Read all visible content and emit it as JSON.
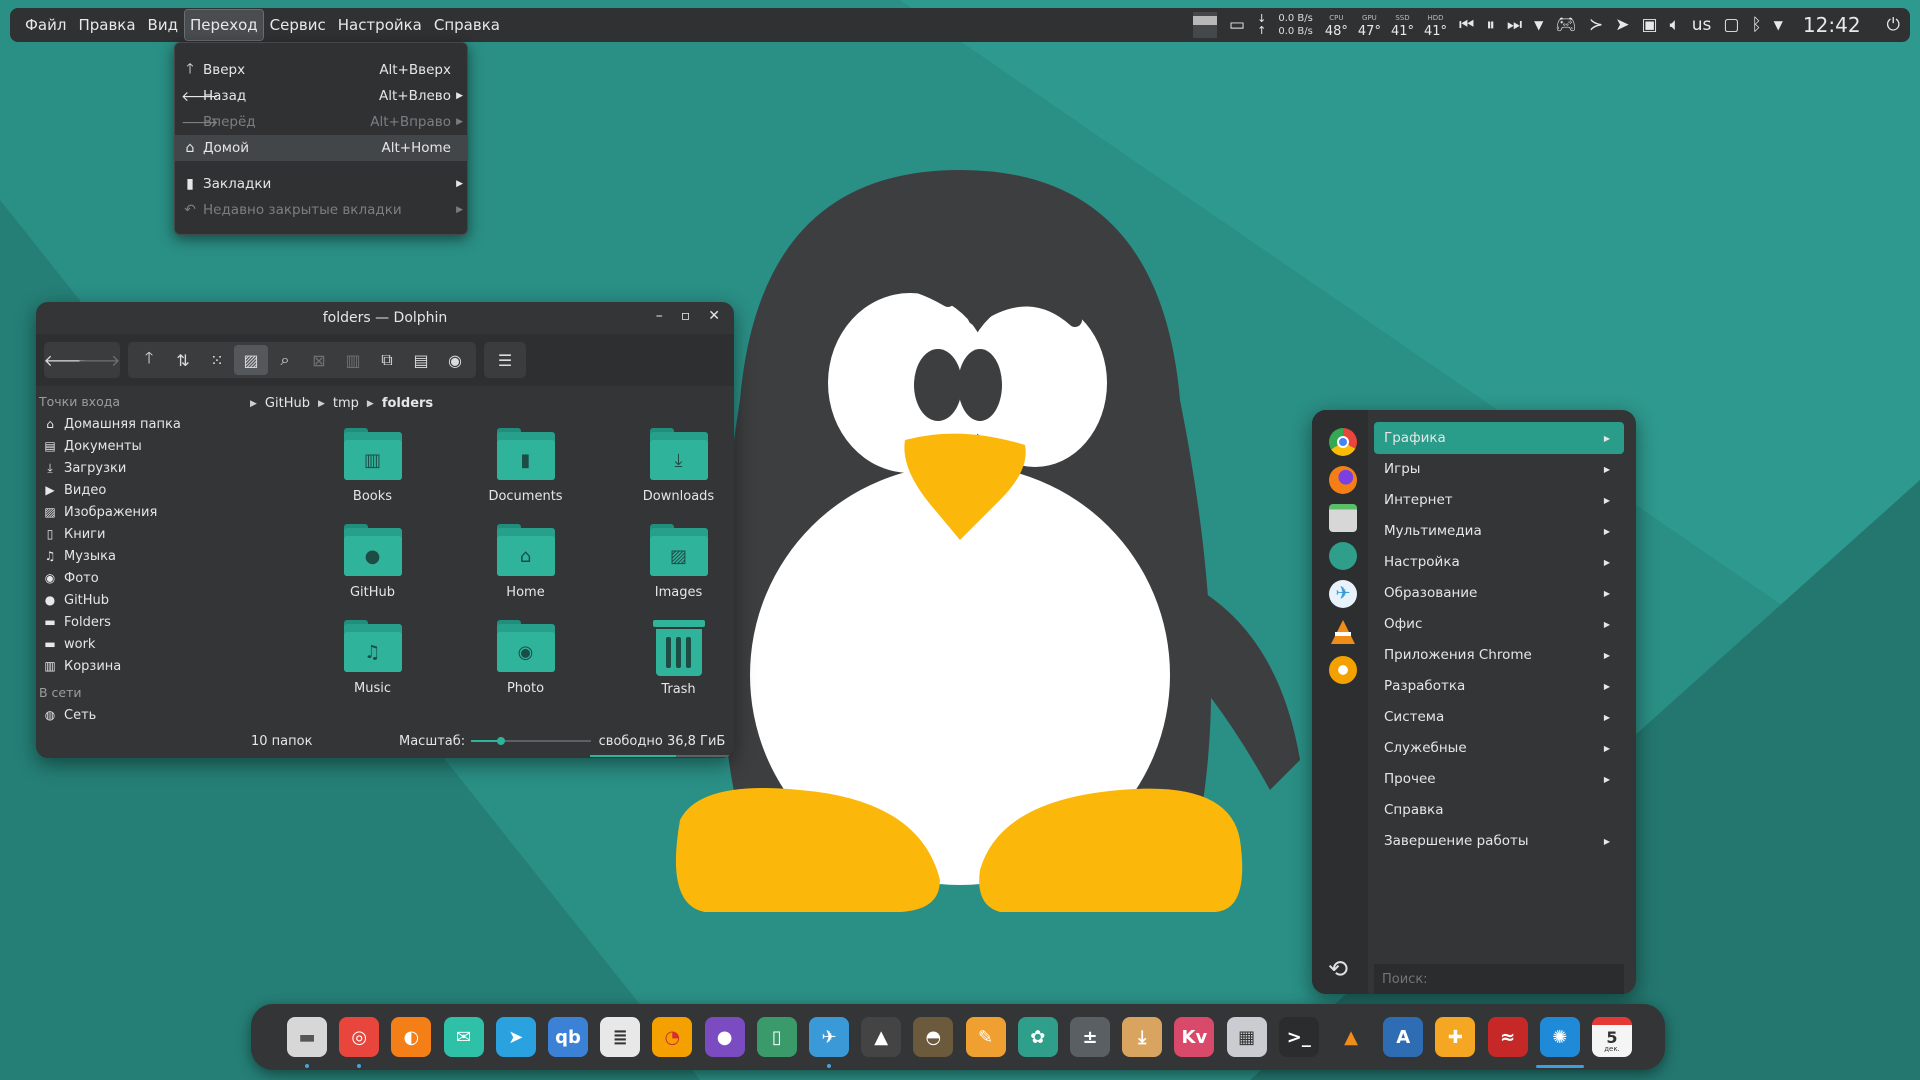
{
  "panel": {
    "menus": [
      "Файл",
      "Правка",
      "Вид",
      "Переход",
      "Сервис",
      "Настройка",
      "Справка"
    ],
    "active_menu": "Переход",
    "net_down": "0.0 B/s",
    "net_up": "0.0 B/s",
    "sensors": [
      {
        "label": "CPU",
        "value": "48°"
      },
      {
        "label": "GPU",
        "value": "47°"
      },
      {
        "label": "SSD",
        "value": "41°"
      },
      {
        "label": "HDD",
        "value": "41°"
      }
    ],
    "keyboard_layout": "us",
    "clock": "12:42"
  },
  "go_menu": {
    "items": [
      {
        "icon": "arrow-up-icon",
        "glyph": "🡑",
        "label": "Вверх",
        "shortcut": "Alt+Вверх",
        "disabled": false,
        "submenu": false
      },
      {
        "icon": "arrow-left-icon",
        "glyph": "🡐",
        "label": "Назад",
        "shortcut": "Alt+Влево",
        "disabled": false,
        "submenu": true
      },
      {
        "icon": "arrow-right-icon",
        "glyph": "🡒",
        "label": "Вперёд",
        "shortcut": "Alt+Вправо",
        "disabled": true,
        "submenu": true
      },
      {
        "icon": "home-icon",
        "glyph": "⌂",
        "label": "Домой",
        "shortcut": "Alt+Home",
        "disabled": false,
        "submenu": false,
        "highlighted": true
      },
      {
        "icon": "bookmark-icon",
        "glyph": "▮",
        "label": "Закладки",
        "shortcut": "",
        "disabled": false,
        "submenu": true
      },
      {
        "icon": "undo-icon",
        "glyph": "↶",
        "label": "Недавно закрытые вкладки",
        "shortcut": "",
        "disabled": true,
        "submenu": true
      }
    ]
  },
  "dolphin": {
    "title": "folders — Dolphin",
    "places_header": "Точки входа",
    "places": [
      {
        "icon": "home-icon",
        "glyph": "⌂",
        "label": "Домашняя папка"
      },
      {
        "icon": "document-icon",
        "glyph": "▤",
        "label": "Документы"
      },
      {
        "icon": "download-icon",
        "glyph": "⤓",
        "label": "Загрузки"
      },
      {
        "icon": "video-icon",
        "glyph": "▶",
        "label": "Видео"
      },
      {
        "icon": "image-icon",
        "glyph": "▨",
        "label": "Изображения"
      },
      {
        "icon": "book-icon",
        "glyph": "▯",
        "label": "Книги"
      },
      {
        "icon": "music-icon",
        "glyph": "♫",
        "label": "Музыка"
      },
      {
        "icon": "camera-icon",
        "glyph": "◉",
        "label": "Фото"
      },
      {
        "icon": "github-icon",
        "glyph": "●",
        "label": "GitHub"
      },
      {
        "icon": "folder-icon",
        "glyph": "▬",
        "label": "Folders"
      },
      {
        "icon": "folder-icon",
        "glyph": "▬",
        "label": "work"
      },
      {
        "icon": "trash-icon",
        "glyph": "▥",
        "label": "Корзина"
      }
    ],
    "network_header": "В сети",
    "network_item": "Сеть",
    "breadcrumb": [
      "GitHub",
      "tmp",
      "folders"
    ],
    "files": [
      {
        "name": "Books",
        "icon": "book-icon",
        "glyph": "▥"
      },
      {
        "name": "Documents",
        "icon": "document-icon",
        "glyph": "▮"
      },
      {
        "name": "Downloads",
        "icon": "download-icon",
        "glyph": "⤓"
      },
      {
        "name": "GitHub",
        "icon": "github-icon",
        "glyph": "●"
      },
      {
        "name": "Home",
        "icon": "home-icon",
        "glyph": "⌂"
      },
      {
        "name": "Images",
        "icon": "image-icon",
        "glyph": "▨"
      },
      {
        "name": "Music",
        "icon": "music-icon",
        "glyph": "♫"
      },
      {
        "name": "Photo",
        "icon": "camera-icon",
        "glyph": "◉"
      },
      {
        "name": "Trash",
        "icon": "trash-icon",
        "glyph": ""
      }
    ],
    "status_count": "10 папок",
    "zoom_label": "Масштаб:",
    "zoom_level": 0.25,
    "free_space": "свободно 36,8 ГиБ",
    "disk_usage": 0.6
  },
  "launcher": {
    "categories": [
      {
        "label": "Графика",
        "submenu": true,
        "selected": true
      },
      {
        "label": "Игры",
        "submenu": true
      },
      {
        "label": "Интернет",
        "submenu": true
      },
      {
        "label": "Мультимедиа",
        "submenu": true
      },
      {
        "label": "Настройка",
        "submenu": true
      },
      {
        "label": "Образование",
        "submenu": true
      },
      {
        "label": "Офис",
        "submenu": true
      },
      {
        "label": "Приложения Chrome",
        "submenu": true
      },
      {
        "label": "Разработка",
        "submenu": true
      },
      {
        "label": "Система",
        "submenu": true
      },
      {
        "label": "Служебные",
        "submenu": true
      },
      {
        "label": "Прочее",
        "submenu": true
      },
      {
        "label": "Справка",
        "submenu": false
      },
      {
        "label": "Завершение работы",
        "submenu": true
      }
    ],
    "favorites": [
      "chrome-icon",
      "firefox-icon",
      "file-manager-icon",
      "settings-icon",
      "kde-connect-icon",
      "vlc-icon",
      "citrus-icon"
    ],
    "search_placeholder": "Поиск:"
  },
  "dock": {
    "apps": [
      {
        "name": "file-manager-icon",
        "glyph": "▬",
        "bg": "#d7d7d7",
        "fg": "#555",
        "running": true
      },
      {
        "name": "chrome-icon",
        "glyph": "◎",
        "bg": "#e8453c",
        "fg": "#fff",
        "running": true
      },
      {
        "name": "firefox-icon",
        "glyph": "◐",
        "bg": "#f57f17",
        "fg": "#fff",
        "running": false
      },
      {
        "name": "mail-icon",
        "glyph": "✉",
        "bg": "#2fc0a8",
        "fg": "#fff",
        "running": false
      },
      {
        "name": "telegram-icon",
        "glyph": "➤",
        "bg": "#2aa2e0",
        "fg": "#fff",
        "running": false
      },
      {
        "name": "qbittorrent-icon",
        "glyph": "qb",
        "bg": "#3b82d6",
        "fg": "#fff",
        "running": false
      },
      {
        "name": "ebook-reader-icon",
        "glyph": "≣",
        "bg": "#e8e8e8",
        "fg": "#333",
        "running": false
      },
      {
        "name": "disc-burner-icon",
        "glyph": "◔",
        "bg": "#f4a100",
        "fg": "#d32f2f",
        "running": false
      },
      {
        "name": "github-desktop-icon",
        "glyph": "●",
        "bg": "#7b4bc2",
        "fg": "#fff",
        "running": false
      },
      {
        "name": "dictionary-icon",
        "glyph": "▯",
        "bg": "#3a9a6a",
        "fg": "#fff",
        "running": false
      },
      {
        "name": "kde-connect-icon",
        "glyph": "✈",
        "bg": "#3a9ad8",
        "fg": "#fff",
        "running": true
      },
      {
        "name": "inkscape-icon",
        "glyph": "▲",
        "bg": "#444",
        "fg": "#fff",
        "running": false
      },
      {
        "name": "gimp-icon",
        "glyph": "◓",
        "bg": "#6b5a3c",
        "fg": "#fff",
        "running": false
      },
      {
        "name": "color-picker-icon",
        "glyph": "✎",
        "bg": "#f0a030",
        "fg": "#fff",
        "running": false
      },
      {
        "name": "settings-icon",
        "glyph": "✿",
        "bg": "#2f9e8a",
        "fg": "#fff",
        "running": false
      },
      {
        "name": "calculator-icon",
        "glyph": "±",
        "bg": "#5a5f63",
        "fg": "#fff",
        "running": false
      },
      {
        "name": "archive-icon",
        "glyph": "⤓",
        "bg": "#d9a460",
        "fg": "#fff",
        "running": false
      },
      {
        "name": "kvantum-icon",
        "glyph": "Kv",
        "bg": "#d94a6a",
        "fg": "#fff",
        "running": false
      },
      {
        "name": "system-monitor-icon",
        "glyph": "▦",
        "bg": "#c9ccd0",
        "fg": "#333",
        "running": false
      },
      {
        "name": "terminal-icon",
        "glyph": ">_",
        "bg": "#2a2c2e",
        "fg": "#fff",
        "running": false
      },
      {
        "name": "vlc-icon",
        "glyph": "▲",
        "bg": "#333537",
        "fg": "#f08c1a",
        "running": false
      },
      {
        "name": "android-studio-icon",
        "glyph": "A",
        "bg": "#2e6db4",
        "fg": "#fff",
        "running": false
      },
      {
        "name": "game-controller-icon",
        "glyph": "✚",
        "bg": "#f5a623",
        "fg": "#fff",
        "running": false
      },
      {
        "name": "ruby-icon",
        "glyph": "≈",
        "bg": "#c62828",
        "fg": "#fff",
        "running": false
      },
      {
        "name": "kde-icon",
        "glyph": "✺",
        "bg": "#1f8ad8",
        "fg": "#fff",
        "running": true
      },
      {
        "name": "calendar-icon",
        "glyph": "5",
        "bg": "#f5f5f5",
        "fg": "#333",
        "running": false
      }
    ],
    "calendar_day": "5",
    "calendar_month": "дек."
  }
}
